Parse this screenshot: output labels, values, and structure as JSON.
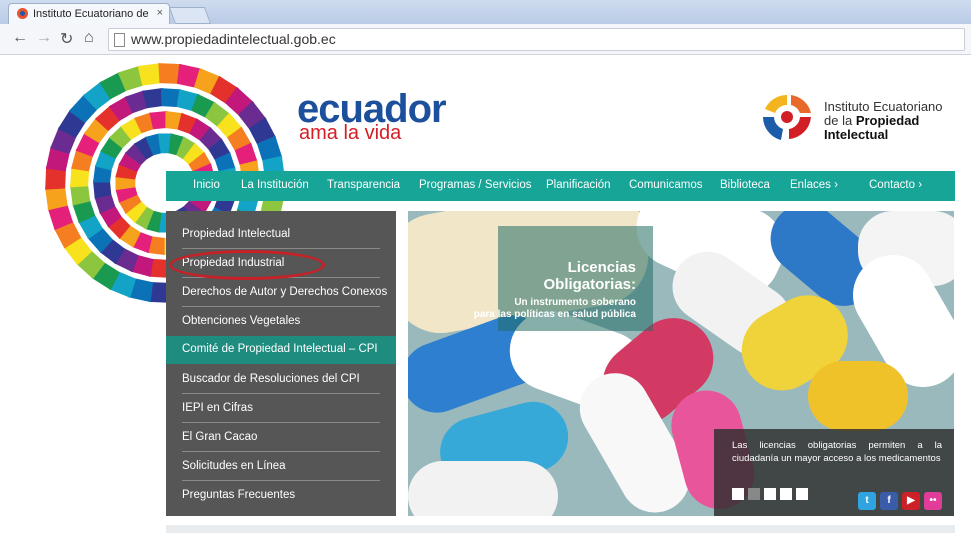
{
  "browser": {
    "tab_title": "Instituto Ecuatoriano de la",
    "tab_close": "×",
    "url": "www.propiedadintelectual.gob.ec",
    "icons": [
      "back-icon",
      "forward-icon",
      "reload-icon",
      "home-icon",
      "page-icon"
    ]
  },
  "brand": {
    "line1": "ecuador",
    "line2": "ama la vida",
    "institute_line1": "Instituto Ecuatoriano",
    "institute_line2_prefix": "de la ",
    "institute_line2_bold": "Propiedad",
    "institute_line3": "Intelectual"
  },
  "nav": [
    {
      "label": "Inicio"
    },
    {
      "label": "La Institución"
    },
    {
      "label": "Transparencia"
    },
    {
      "label": "Programas / Servicios"
    },
    {
      "label": "Planificación"
    },
    {
      "label": "Comunicamos"
    },
    {
      "label": "Biblioteca"
    },
    {
      "label": "Enlaces ›"
    },
    {
      "label": "Contacto ›"
    }
  ],
  "sidebar": [
    {
      "label": "Propiedad Intelectual"
    },
    {
      "label": "Propiedad Industrial"
    },
    {
      "label": "Derechos de Autor y Derechos Conexos"
    },
    {
      "label": "Obtenciones Vegetales"
    },
    {
      "label": "Comité de Propiedad Intelectual – CPI"
    },
    {
      "label": "Buscador de Resoluciones del CPI"
    },
    {
      "label": "IEPI en Cifras"
    },
    {
      "label": "El Gran Cacao"
    },
    {
      "label": "Solicitudes en Línea"
    },
    {
      "label": "Preguntas Frecuentes"
    }
  ],
  "hero": {
    "title_line1": "Licencias",
    "title_line2": "Obligatorias:",
    "sub_line1": "Un instrumento soberano",
    "sub_line2": "para las políticas en salud pública",
    "caption": "Las licencias obligatorias permiten a la ciudadanía un mayor acceso a los medicamentos",
    "social": [
      "twitter-icon",
      "facebook-icon",
      "youtube-icon",
      "flickr-icon"
    ]
  },
  "colors": {
    "accent": "#16a596",
    "sidebar": "#565656",
    "active": "#1f8c80",
    "highlight_ring": "#c62127"
  }
}
